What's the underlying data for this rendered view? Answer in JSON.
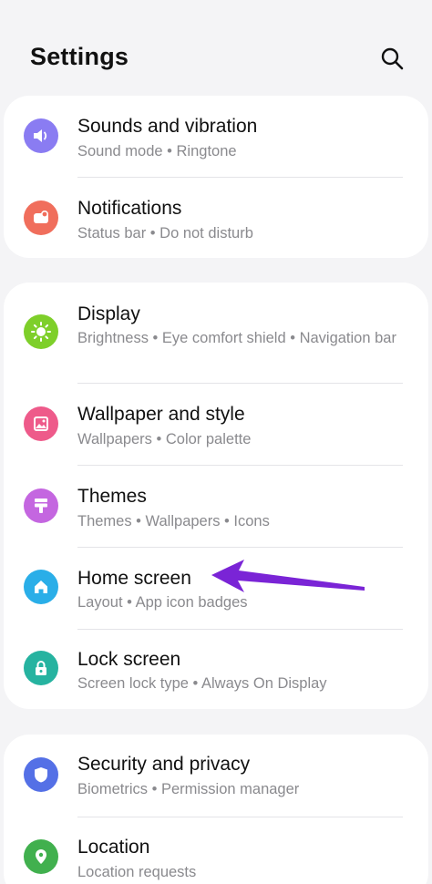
{
  "header": {
    "title": "Settings",
    "search_icon": "search-icon"
  },
  "groups": [
    {
      "items": [
        {
          "title": "Sounds and vibration",
          "subtitle": "Sound mode  •  Ringtone",
          "icon": "volume-icon",
          "color": "#8a7cf2"
        },
        {
          "title": "Notifications",
          "subtitle": "Status bar  •  Do not disturb",
          "icon": "notification-icon",
          "color": "#f06e5c"
        }
      ]
    },
    {
      "items": [
        {
          "title": "Display",
          "subtitle": "Brightness  •  Eye comfort shield  •  Navigation bar",
          "icon": "brightness-icon",
          "color": "#7ecf2a"
        },
        {
          "title": "Wallpaper and style",
          "subtitle": "Wallpapers  •  Color palette",
          "icon": "image-icon",
          "color": "#ee5a8a"
        },
        {
          "title": "Themes",
          "subtitle": "Themes  •  Wallpapers  •  Icons",
          "icon": "paint-brush-icon",
          "color": "#c466e0"
        },
        {
          "title": "Home screen",
          "subtitle": "Layout  •  App icon badges",
          "icon": "home-icon",
          "color": "#2aaee8"
        },
        {
          "title": "Lock screen",
          "subtitle": "Screen lock type  •  Always On Display",
          "icon": "lock-icon",
          "color": "#26b3a0"
        }
      ]
    },
    {
      "items": [
        {
          "title": "Security and privacy",
          "subtitle": "Biometrics  •  Permission manager",
          "icon": "shield-icon",
          "color": "#5470e6"
        },
        {
          "title": "Location",
          "subtitle": "Location requests",
          "icon": "location-pin-icon",
          "color": "#41b04e"
        }
      ]
    }
  ],
  "annotation": {
    "color": "#7a24d6",
    "icon": "arrow-pointer-icon"
  }
}
